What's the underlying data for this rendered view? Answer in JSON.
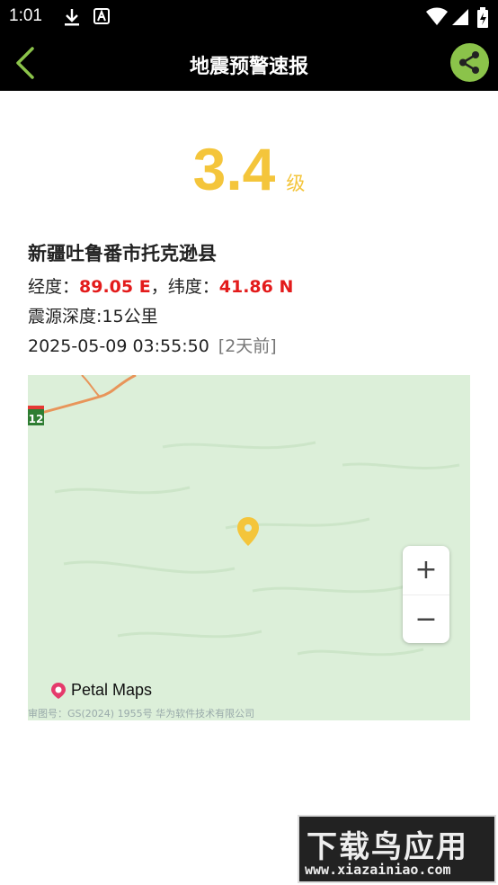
{
  "status_bar": {
    "time": "1:01"
  },
  "header": {
    "title": "地震预警速报"
  },
  "quake": {
    "magnitude": "3.4",
    "unit": "级",
    "location": "新疆吐鲁番市托克逊县",
    "lon_label": "经度：",
    "lon_value": "89.05 E",
    "sep": "，",
    "lat_label": "纬度：",
    "lat_value": "41.86 N",
    "depth": "震源深度:15公里",
    "datetime": "2025-05-09 03:55:50",
    "ago": "[2天前]"
  },
  "map": {
    "route_badge": "12",
    "zoom_in": "+",
    "zoom_out": "−",
    "brand": "Petal Maps",
    "copyright": "审图号：GS(2024) 1955号 华为软件技术有限公司"
  },
  "watermark": {
    "title": "下载鸟应用",
    "url": "www.xiazainiao.com"
  },
  "colors": {
    "magnitude": "#f4c53b",
    "coord": "#e31b1b",
    "share": "#8bc34a",
    "back": "#8bc34a"
  }
}
